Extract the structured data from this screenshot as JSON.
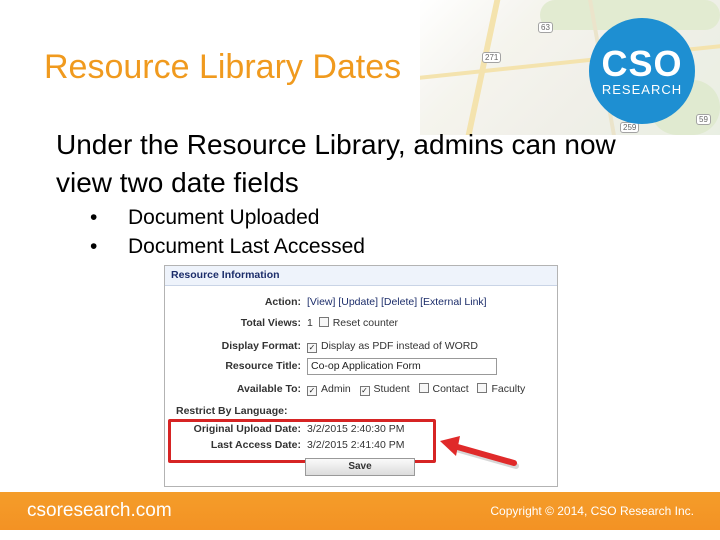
{
  "slide": {
    "title": "Resource Library Dates",
    "intro": "Under the Resource Library, admins can now view two date fields",
    "bullets": [
      "Document Uploaded",
      "Document Last Accessed"
    ]
  },
  "logo": {
    "top": "CSO",
    "bottom": "RESEARCH"
  },
  "map_shields": [
    "63",
    "271",
    "259",
    "59"
  ],
  "panel": {
    "header": "Resource Information",
    "action_label": "Action:",
    "actions": [
      "[View]",
      "[Update]",
      "[Delete]",
      "[External Link]"
    ],
    "total_views_label": "Total Views:",
    "total_views_value": "1",
    "reset_counter_label": "Reset counter",
    "display_format_label": "Display Format:",
    "display_format_option": "Display as PDF instead of WORD",
    "resource_title_label": "Resource Title:",
    "resource_title_value": "Co-op Application Form",
    "available_to_label": "Available To:",
    "available_to": [
      "Admin",
      "Student",
      "Contact",
      "Faculty"
    ],
    "restrict_label": "Restrict By Language:",
    "upload_label": "Original Upload Date:",
    "upload_value": "3/2/2015 2:40:30 PM",
    "last_access_label": "Last Access Date:",
    "last_access_value": "3/2/2015 2:41:40 PM",
    "save_label": "Save"
  },
  "footer": {
    "site": "csoresearch.com",
    "copyright": "Copyright © 2014, CSO Research Inc."
  },
  "colors": {
    "title": "#f09a1e",
    "logo": "#1e8fd2",
    "footer": "#f39224",
    "highlight": "#d62424"
  }
}
